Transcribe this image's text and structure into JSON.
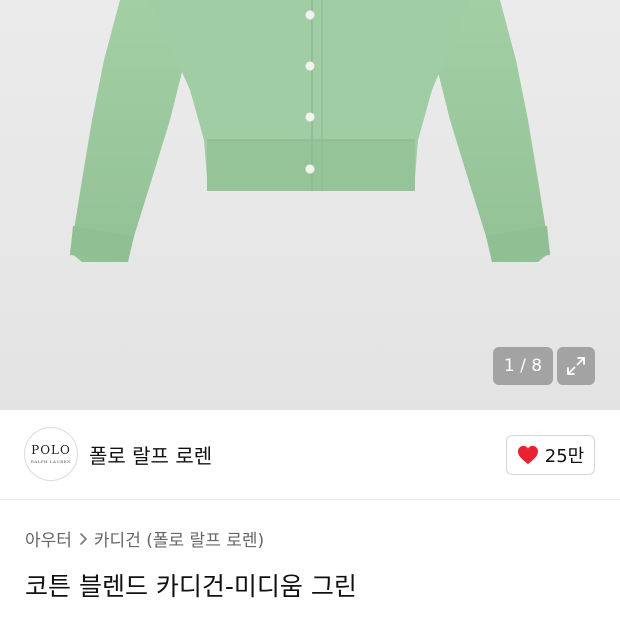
{
  "gallery": {
    "counter": "1 / 8",
    "current_page": 1,
    "total_pages": 8,
    "product_color": "#9dc9a0"
  },
  "brand": {
    "logo_text": "POLO",
    "logo_subtext": "RALPH LAUREN",
    "name": "폴로 랄프 로렌"
  },
  "like": {
    "count": "25만",
    "icon": "heart-icon",
    "color": "#e8232f"
  },
  "breadcrumb": {
    "items": [
      "아우터",
      "카디건 (폴로 랄프 로렌)"
    ],
    "separator_icon": "chevron-right-icon"
  },
  "product": {
    "title": "코튼 블렌드 카디건-미디움 그린"
  }
}
